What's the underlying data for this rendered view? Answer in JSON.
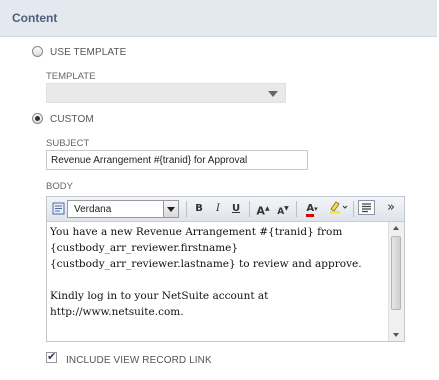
{
  "section": {
    "title": "Content"
  },
  "options": {
    "use_template_label": "USE TEMPLATE",
    "custom_label": "CUSTOM",
    "selected": "custom"
  },
  "template": {
    "label": "TEMPLATE",
    "value": ""
  },
  "subject": {
    "label": "SUBJECT",
    "value": "Revenue Arrangement #{tranid} for Approval"
  },
  "body": {
    "label": "BODY",
    "font": "Verdana",
    "toolbar": {
      "bold": "B",
      "italic": "I",
      "underline": "U",
      "grow": "A",
      "shrink": "A",
      "font_color": "A",
      "more": "»"
    },
    "text": "You have a new Revenue Arrangement #{tranid} from\n{custbody_arr_reviewer.firstname}\n{custbody_arr_reviewer.lastname} to review and approve.\n\nKindly log in to your NetSuite account at\nhttp://www.netsuite.com."
  },
  "include_link": {
    "label": "INCLUDE VIEW RECORD LINK",
    "checked": true
  }
}
